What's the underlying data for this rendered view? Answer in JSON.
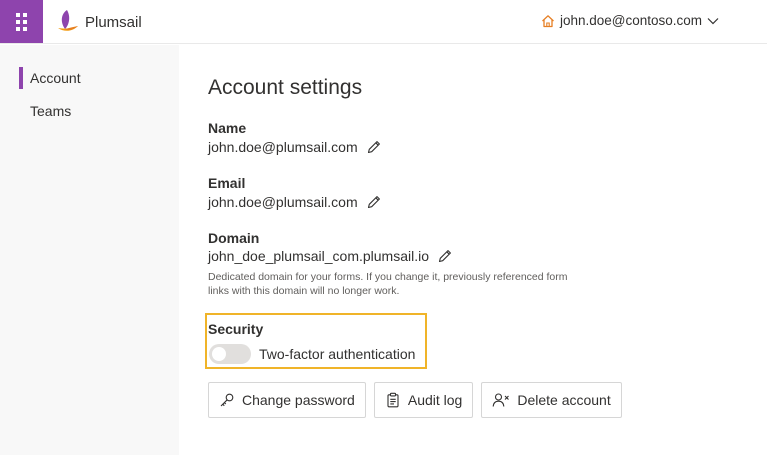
{
  "header": {
    "brand": "Plumsail",
    "user_email": "john.doe@contoso.com",
    "launcher_icon": "waffle-icon",
    "home_icon": "home-icon",
    "chevron_icon": "chevron-down-icon",
    "accent_color": "#8e44ad"
  },
  "sidebar": {
    "items": [
      {
        "label": "Account",
        "active": true
      },
      {
        "label": "Teams",
        "active": false
      }
    ]
  },
  "main": {
    "title": "Account settings",
    "fields": {
      "name": {
        "label": "Name",
        "value": "john.doe@plumsail.com"
      },
      "email": {
        "label": "Email",
        "value": "john.doe@plumsail.com"
      },
      "domain": {
        "label": "Domain",
        "value": "john_doe_plumsail_com.plumsail.io"
      }
    },
    "domain_help": "Dedicated domain for your forms. If you change it, previously referenced form links with this domain will no longer work.",
    "security": {
      "label": "Security",
      "two_factor_label": "Two-factor authentication",
      "two_factor_enabled": false,
      "highlight_color": "#f0b429"
    },
    "buttons": {
      "change_password": "Change password",
      "audit_log": "Audit log",
      "delete_account": "Delete account"
    }
  }
}
